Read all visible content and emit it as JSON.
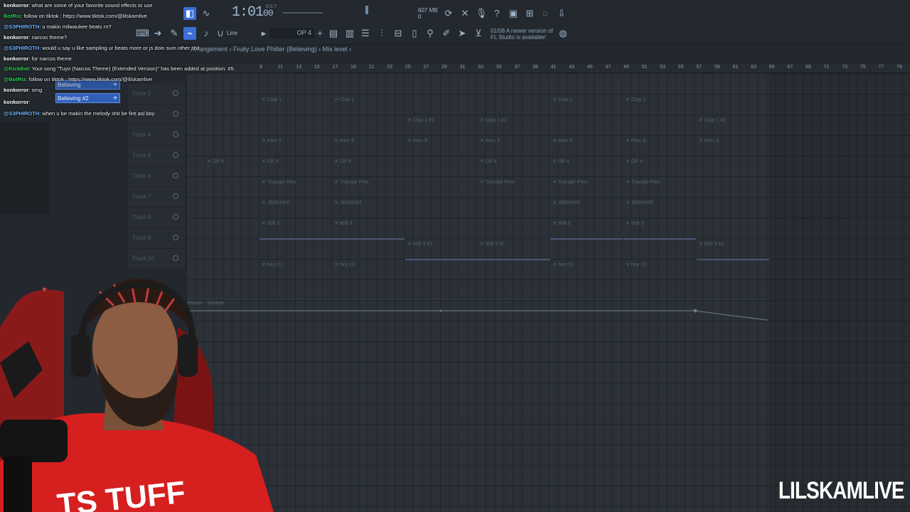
{
  "toolbar": {
    "clock": "1:01",
    "clock_small": "00",
    "clock_unit": "B:S:T",
    "memory": "607 MB",
    "memory_sub": "0",
    "pattern": "OP 4",
    "snap": "Line",
    "news": [
      "01/08  A newer version of",
      "FL Studio is available!"
    ]
  },
  "breadcrumb": [
    "Arrangement",
    "Fruity Love Philter (Believing)",
    "Mix level"
  ],
  "ruler": [
    "9",
    "11",
    "13",
    "15",
    "17",
    "19",
    "21",
    "23",
    "25",
    "27",
    "29",
    "31",
    "33",
    "35",
    "37",
    "39",
    "41",
    "43",
    "45",
    "47",
    "49",
    "51",
    "53",
    "55",
    "57",
    "59",
    "61",
    "63",
    "65",
    "67",
    "69",
    "71",
    "73",
    "75",
    "77",
    "79"
  ],
  "tracks": [
    "Track 2",
    "Track 3",
    "Track 4",
    "Track 5",
    "Track 6",
    "Track 7",
    "Track 8",
    "Track 9",
    "Track 10"
  ],
  "clips": {
    "clap1": "Clap 1",
    "clap1b": "Clap 1 #2",
    "perc9": "Perc 9",
    "op4": "OP 4",
    "triangle": "Triangle Perc",
    "jerk": "JERKHAT",
    "eight08_3": "808 3",
    "eight08_3b": "808 3 #2",
    "hey": "hey (1)"
  },
  "automation_label": "Master - Volume",
  "rack": {
    "item1": "Believing",
    "item2": "Believing #2"
  },
  "chat": [
    {
      "user": "konkorror",
      "text": ": what are some of your favorite sound effects to use",
      "color": "#ffffff"
    },
    {
      "user": "BotRix",
      "text": ": follow on tiktok : https://www.tiktok.com/@lilskamlive",
      "color": "#37d15a"
    },
    {
      "user": "@S3PHIROTH",
      "text": ": u makin milwaukee beats rn?",
      "color": "#6fb5ff"
    },
    {
      "user": "konkorror",
      "text": ": narcos theme?",
      "color": "#ffffff"
    },
    {
      "user": "@S3PHIROTH",
      "text": ": would u say u like sampling ur beats more or js doin sum other shit",
      "color": "#6fb5ff"
    },
    {
      "user": "konkorror",
      "text": ": for narcos theme",
      "color": "#ffffff"
    },
    {
      "user": "@KickBot",
      "text": ": Your song \"Tuyo (Narcos Theme) (Extended Version)\" has been added at position: #5.",
      "color": "#37d15a"
    },
    {
      "user": "@BotRix",
      "text": ": follow on tiktok : https://www.tiktok.com/@lilskamlive",
      "color": "#37d15a"
    },
    {
      "user": "konkorror",
      "text": ": omg",
      "color": "#ffffff"
    },
    {
      "user": "konkorror",
      "text": ":",
      "color": "#ffffff"
    },
    {
      "user": "@S3PHIROTH",
      "text": ": when u be makin the melody shit be fire asl boy",
      "color": "#6fb5ff"
    }
  ],
  "watermark": "LILSKAMLIVE",
  "shirt_text": "TS TUFF"
}
